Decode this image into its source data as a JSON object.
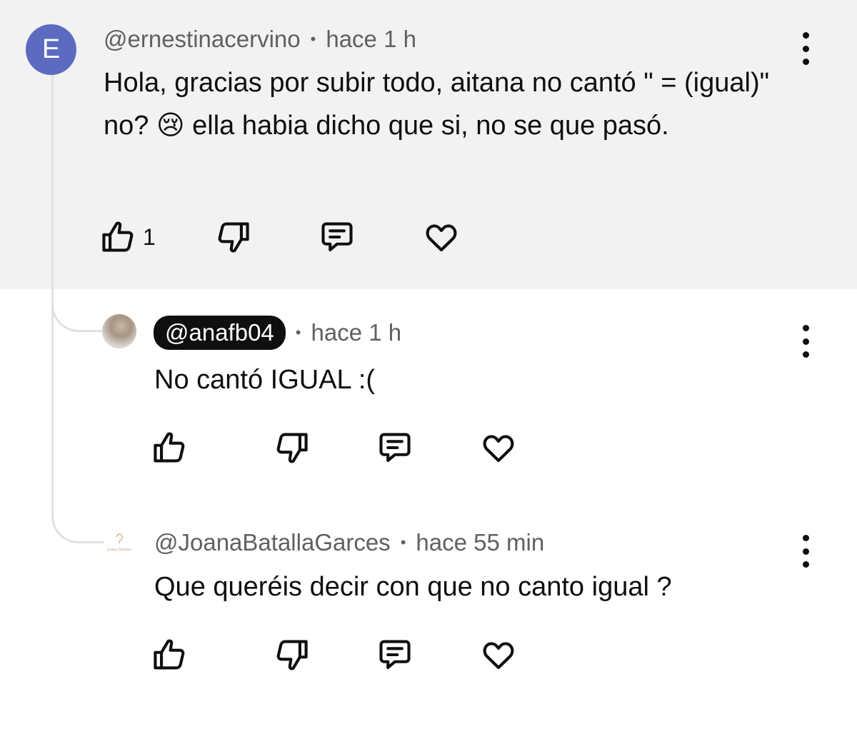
{
  "comments": [
    {
      "avatar_letter": "E",
      "handle": "@ernestinacervino",
      "time": "hace 1 h",
      "text": "Hola, gracias por subir todo, aitana no cantó \" = (igual)\" no? 😢 ella habia dicho que si, no se que pasó.",
      "like_count": "1"
    },
    {
      "handle": "@anafb04",
      "time": "hace 1 h",
      "text": "No cantó IGUAL :("
    },
    {
      "handle": "@JoanaBatallaGarces",
      "time": "hace 55 min",
      "text": "Que queréis decir con que no canto igual ?",
      "avatar_logo_text": "Joana Batalla"
    }
  ],
  "separator": "•",
  "icons": {
    "like": "thumb-up-icon",
    "dislike": "thumb-down-icon",
    "reply": "comment-icon",
    "heart": "heart-icon",
    "menu": "more-vert-icon"
  },
  "colors": {
    "highlight_bg": "#f2f2f2",
    "avatar_e": "#5c6bc0",
    "meta_text": "#606060",
    "thread_line": "#e1e1e1"
  }
}
